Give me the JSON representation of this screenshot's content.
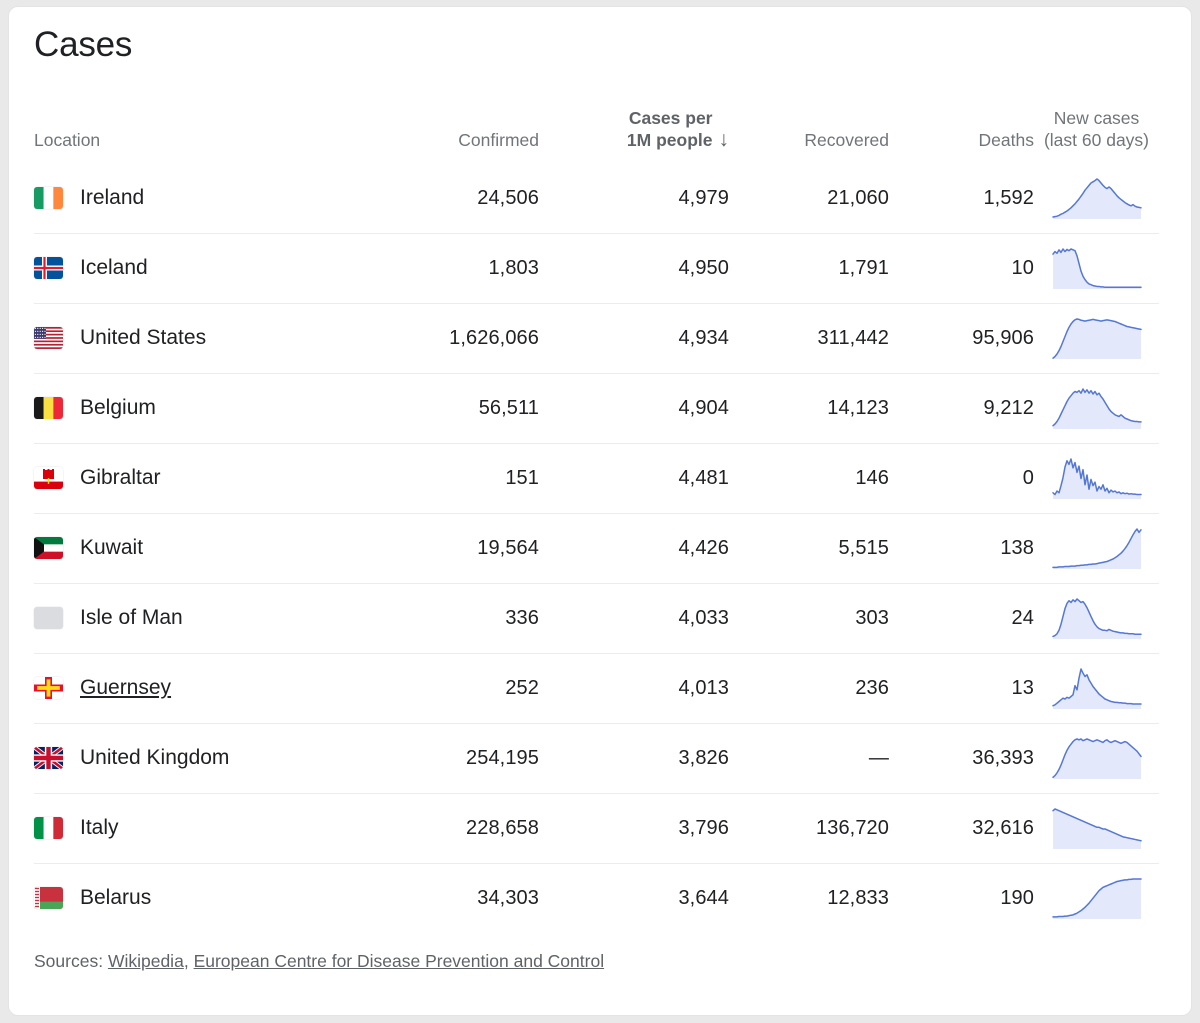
{
  "card": {
    "title": "Cases"
  },
  "table": {
    "headers": {
      "location": "Location",
      "confirmed": "Confirmed",
      "cases_per_1m": "Cases per\n1M people",
      "sort_arrow": "↓",
      "recovered": "Recovered",
      "deaths": "Deaths",
      "new_cases": "New cases\n(last 60 days)"
    },
    "sort": {
      "column": "Cases per 1M people",
      "direction": "descending"
    },
    "rows": [
      {
        "location": "Ireland",
        "flag": "flag-ireland",
        "is_link": false,
        "confirmed": "24,506",
        "cases_per_1m": "4,979",
        "recovered": "21,060",
        "deaths": "1,592",
        "sparkline": [
          5,
          6,
          7,
          9,
          12,
          14,
          17,
          20,
          24,
          28,
          33,
          38,
          44,
          50,
          57,
          64,
          72,
          78,
          84,
          90,
          93,
          96,
          100,
          96,
          90,
          84,
          79,
          76,
          80,
          76,
          70,
          64,
          58,
          53,
          49,
          45,
          41,
          38,
          35,
          33,
          36,
          32,
          30,
          29,
          28
        ]
      },
      {
        "location": "Iceland",
        "flag": "flag-iceland",
        "is_link": false,
        "confirmed": "1,803",
        "cases_per_1m": "4,950",
        "recovered": "1,791",
        "deaths": "10",
        "sparkline": [
          82,
          88,
          84,
          92,
          86,
          94,
          88,
          93,
          90,
          94,
          92,
          90,
          78,
          60,
          42,
          30,
          22,
          16,
          12,
          10,
          8,
          7,
          6,
          6,
          5,
          5,
          4,
          4,
          4,
          4,
          4,
          4,
          4,
          4,
          4,
          4,
          4,
          4,
          4,
          4,
          4,
          4,
          4,
          4,
          4
        ]
      },
      {
        "location": "United States",
        "flag": "flag-united-states",
        "is_link": false,
        "confirmed": "1,626,066",
        "cases_per_1m": "4,934",
        "recovered": "311,442",
        "deaths": "95,906",
        "sparkline": [
          2,
          6,
          12,
          20,
          30,
          42,
          54,
          66,
          76,
          84,
          90,
          94,
          96,
          95,
          93,
          92,
          91,
          92,
          93,
          94,
          95,
          94,
          93,
          92,
          91,
          92,
          93,
          94,
          93,
          92,
          91,
          90,
          88,
          86,
          84,
          82,
          80,
          78,
          77,
          76,
          75,
          74,
          73,
          72,
          71
        ]
      },
      {
        "location": "Belgium",
        "flag": "flag-belgium",
        "is_link": false,
        "confirmed": "56,511",
        "cases_per_1m": "4,904",
        "recovered": "14,123",
        "deaths": "9,212",
        "sparkline": [
          8,
          12,
          18,
          26,
          36,
          46,
          56,
          66,
          74,
          80,
          86,
          90,
          88,
          92,
          86,
          96,
          88,
          94,
          86,
          92,
          84,
          90,
          82,
          86,
          78,
          72,
          64,
          56,
          48,
          42,
          38,
          34,
          32,
          30,
          34,
          30,
          26,
          24,
          22,
          20,
          19,
          18,
          18,
          17,
          17
        ]
      },
      {
        "location": "Gibraltar",
        "flag": "flag-gibraltar",
        "is_link": false,
        "confirmed": "151",
        "cases_per_1m": "4,481",
        "recovered": "146",
        "deaths": "0",
        "sparkline": [
          14,
          10,
          18,
          14,
          30,
          48,
          72,
          86,
          78,
          90,
          70,
          82,
          60,
          74,
          46,
          66,
          32,
          54,
          22,
          44,
          30,
          38,
          18,
          28,
          22,
          32,
          18,
          24,
          14,
          20,
          16,
          18,
          14,
          16,
          12,
          14,
          12,
          13,
          11,
          12,
          11,
          11,
          10,
          10,
          10
        ]
      },
      {
        "location": "Kuwait",
        "flag": "flag-kuwait",
        "is_link": false,
        "confirmed": "19,564",
        "cases_per_1m": "4,426",
        "recovered": "5,515",
        "deaths": "138",
        "sparkline": [
          4,
          4,
          4,
          5,
          5,
          5,
          6,
          6,
          6,
          7,
          7,
          7,
          8,
          8,
          9,
          9,
          10,
          10,
          11,
          11,
          12,
          12,
          13,
          14,
          15,
          16,
          17,
          18,
          20,
          22,
          24,
          27,
          30,
          34,
          38,
          43,
          49,
          56,
          64,
          73,
          82,
          90,
          96,
          88,
          94
        ]
      },
      {
        "location": "Isle of Man",
        "flag": "flag-placeholder",
        "is_link": false,
        "confirmed": "336",
        "cases_per_1m": "4,033",
        "recovered": "303",
        "deaths": "24",
        "sparkline": [
          6,
          8,
          12,
          20,
          34,
          52,
          70,
          82,
          88,
          84,
          90,
          86,
          92,
          88,
          84,
          86,
          80,
          72,
          62,
          52,
          42,
          34,
          28,
          24,
          22,
          20,
          20,
          19,
          22,
          20,
          18,
          17,
          16,
          15,
          14,
          14,
          13,
          13,
          12,
          12,
          12,
          11,
          11,
          11,
          11
        ]
      },
      {
        "location": "Guernsey",
        "flag": "flag-guernsey",
        "is_link": true,
        "confirmed": "252",
        "cases_per_1m": "4,013",
        "recovered": "236",
        "deaths": "13",
        "sparkline": [
          8,
          10,
          14,
          18,
          22,
          26,
          24,
          28,
          26,
          30,
          34,
          56,
          46,
          74,
          96,
          86,
          78,
          82,
          70,
          62,
          54,
          48,
          42,
          36,
          32,
          28,
          24,
          22,
          20,
          18,
          17,
          16,
          16,
          15,
          15,
          14,
          14,
          13,
          13,
          13,
          12,
          12,
          12,
          12,
          12
        ]
      },
      {
        "location": "United Kingdom",
        "flag": "flag-united-kingdom",
        "is_link": false,
        "confirmed": "254,195",
        "cases_per_1m": "3,826",
        "recovered": "—",
        "deaths": "36,393",
        "sparkline": [
          4,
          8,
          14,
          22,
          32,
          44,
          56,
          66,
          74,
          80,
          86,
          90,
          92,
          90,
          92,
          88,
          90,
          92,
          90,
          88,
          86,
          88,
          90,
          88,
          86,
          84,
          88,
          90,
          86,
          84,
          86,
          88,
          86,
          84,
          82,
          84,
          86,
          84,
          80,
          76,
          72,
          68,
          64,
          58,
          52
        ]
      },
      {
        "location": "Italy",
        "flag": "flag-italy",
        "is_link": false,
        "confirmed": "228,658",
        "cases_per_1m": "3,796",
        "recovered": "136,720",
        "deaths": "32,616",
        "sparkline": [
          88,
          92,
          90,
          88,
          86,
          84,
          82,
          80,
          78,
          76,
          74,
          72,
          70,
          68,
          66,
          64,
          62,
          60,
          58,
          56,
          54,
          52,
          50,
          50,
          48,
          46,
          46,
          44,
          42,
          40,
          38,
          36,
          34,
          32,
          30,
          28,
          27,
          26,
          25,
          24,
          23,
          22,
          21,
          20,
          19
        ]
      },
      {
        "location": "Belarus",
        "flag": "flag-belarus",
        "is_link": false,
        "confirmed": "34,303",
        "cases_per_1m": "3,644",
        "recovered": "12,833",
        "deaths": "190",
        "sparkline": [
          5,
          5,
          5,
          6,
          6,
          6,
          7,
          7,
          8,
          9,
          10,
          12,
          14,
          17,
          20,
          24,
          28,
          33,
          38,
          44,
          50,
          56,
          62,
          68,
          72,
          76,
          78,
          80,
          82,
          84,
          86,
          88,
          90,
          91,
          92,
          93,
          94,
          94,
          95,
          95,
          96,
          96,
          96,
          96,
          96
        ]
      }
    ]
  },
  "footer": {
    "label": "Sources:",
    "links": [
      "Wikipedia",
      "European Centre for Disease Prevention and Control"
    ],
    "separator": ","
  },
  "colors": {
    "sparkline_stroke": "#5577d6",
    "sparkline_fill": "#e3e9fb",
    "header_text": "#70757a",
    "sort_text": "#5f6368",
    "body_text": "#202124",
    "divider": "#ececec"
  }
}
